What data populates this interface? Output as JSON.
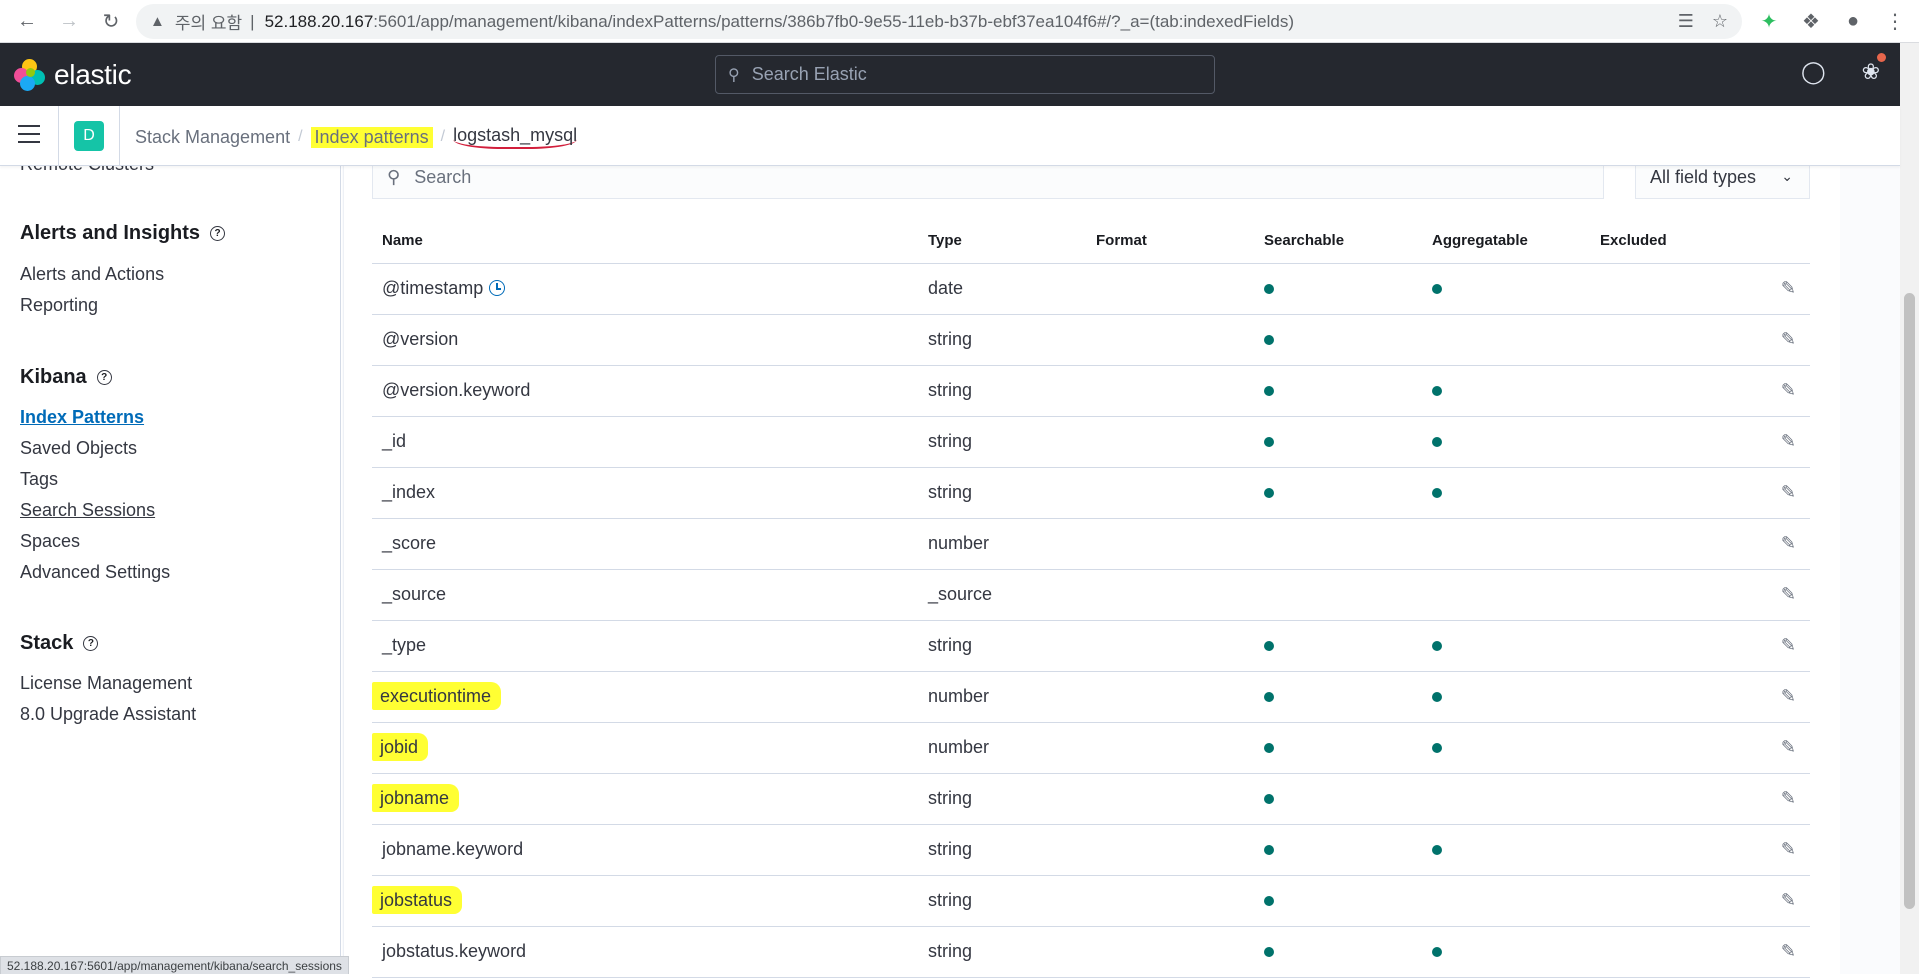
{
  "browser": {
    "security_text": "주의 요함",
    "url_host": "52.188.20.167",
    "url_rest": ":5601/app/management/kibana/indexPatterns/patterns/386b7fb0-9e55-11eb-b37b-ebf37ea104f6#/?_a=(tab:indexedFields)"
  },
  "header": {
    "logo_text": "elastic",
    "search_placeholder": "Search Elastic"
  },
  "breadcrumbs": {
    "space_initial": "D",
    "items": [
      "Stack Management",
      "Index patterns",
      "logstash_mysql"
    ]
  },
  "sidebar": {
    "cut_item": "Remote Clusters",
    "sections": [
      {
        "title": "Alerts and Insights",
        "items": [
          "Alerts and Actions",
          "Reporting"
        ]
      },
      {
        "title": "Kibana",
        "items": [
          "Index Patterns",
          "Saved Objects",
          "Tags",
          "Search Sessions",
          "Spaces",
          "Advanced Settings"
        ]
      },
      {
        "title": "Stack",
        "items": [
          "License Management",
          "8.0 Upgrade Assistant"
        ]
      }
    ]
  },
  "fields_table": {
    "search_placeholder": "Search",
    "type_filter": "All field types",
    "columns": [
      "Name",
      "Type",
      "Format",
      "Searchable",
      "Aggregatable",
      "Excluded"
    ],
    "rows": [
      {
        "name": "@timestamp",
        "type": "date",
        "searchable": true,
        "aggregatable": true,
        "highlighted": false,
        "timestamp": true
      },
      {
        "name": "@version",
        "type": "string",
        "searchable": true,
        "aggregatable": false,
        "highlighted": false
      },
      {
        "name": "@version.keyword",
        "type": "string",
        "searchable": true,
        "aggregatable": true,
        "highlighted": false
      },
      {
        "name": "_id",
        "type": "string",
        "searchable": true,
        "aggregatable": true,
        "highlighted": false
      },
      {
        "name": "_index",
        "type": "string",
        "searchable": true,
        "aggregatable": true,
        "highlighted": false
      },
      {
        "name": "_score",
        "type": "number",
        "searchable": false,
        "aggregatable": false,
        "highlighted": false
      },
      {
        "name": "_source",
        "type": "_source",
        "searchable": false,
        "aggregatable": false,
        "highlighted": false
      },
      {
        "name": "_type",
        "type": "string",
        "searchable": true,
        "aggregatable": true,
        "highlighted": false
      },
      {
        "name": "executiontime",
        "type": "number",
        "searchable": true,
        "aggregatable": true,
        "highlighted": true
      },
      {
        "name": "jobid",
        "type": "number",
        "searchable": true,
        "aggregatable": true,
        "highlighted": true
      },
      {
        "name": "jobname",
        "type": "string",
        "searchable": true,
        "aggregatable": false,
        "highlighted": true
      },
      {
        "name": "jobname.keyword",
        "type": "string",
        "searchable": true,
        "aggregatable": true,
        "highlighted": false
      },
      {
        "name": "jobstatus",
        "type": "string",
        "searchable": true,
        "aggregatable": false,
        "highlighted": true
      },
      {
        "name": "jobstatus.keyword",
        "type": "string",
        "searchable": true,
        "aggregatable": true,
        "highlighted": false
      }
    ]
  },
  "status_bar": {
    "url": "52.188.20.167:5601/app/management/kibana/search_sessions"
  },
  "colors": {
    "header_bg": "#25282f",
    "accent_link": "#006bb8",
    "dot": "#00726b",
    "highlight": "#ffff33"
  }
}
